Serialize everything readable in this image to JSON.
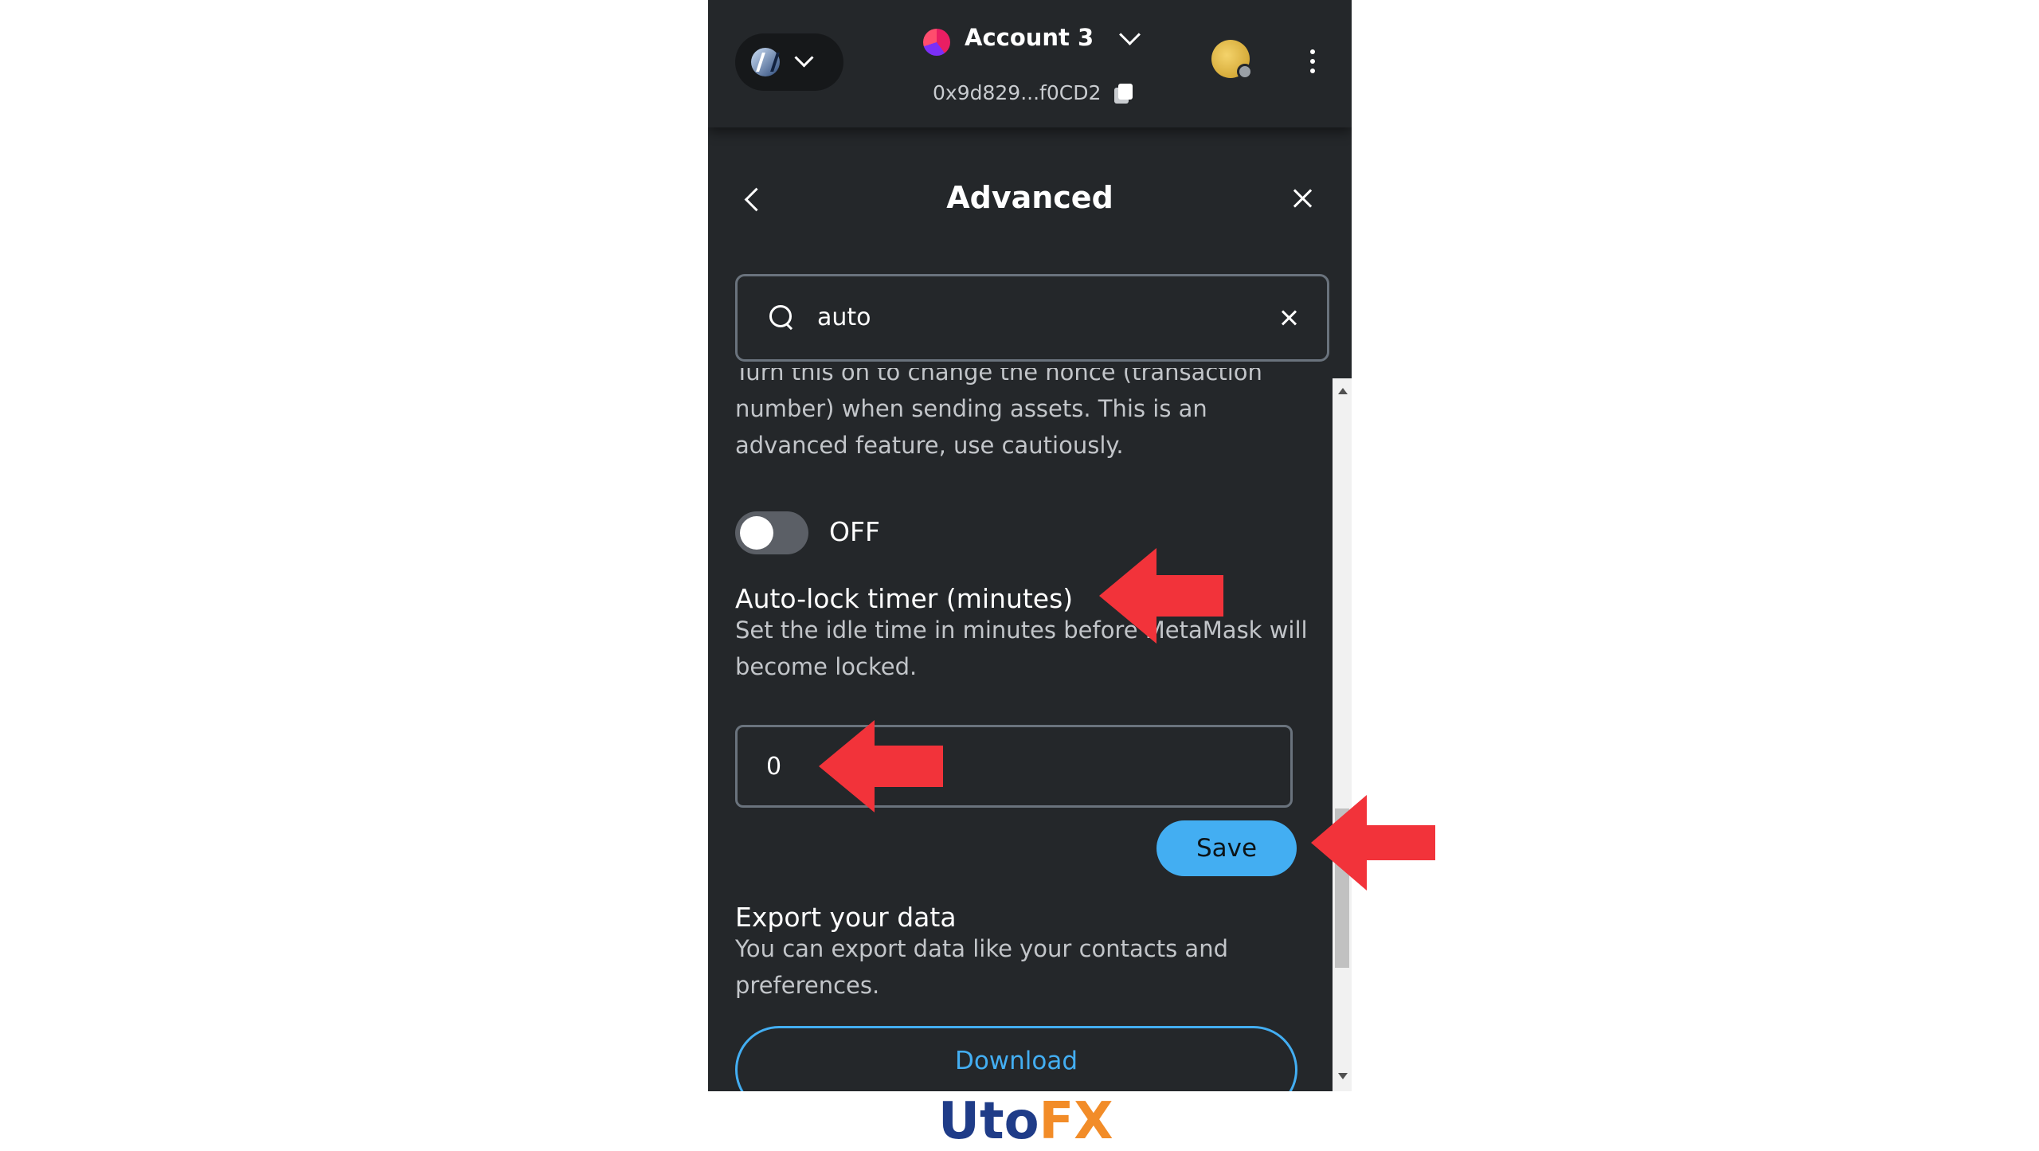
{
  "header": {
    "account_name": "Account 3",
    "address": "0x9d829...f0CD2"
  },
  "page": {
    "title": "Advanced"
  },
  "search": {
    "value": "auto"
  },
  "settings": {
    "nonce_desc": "Turn this on to change the nonce (transaction number) when sending assets. This is an advanced feature, use cautiously.",
    "toggle_label": "OFF",
    "autolock_title": "Auto-lock timer (minutes)",
    "autolock_desc": "Set the idle time in minutes before MetaMask will become locked.",
    "autolock_value": "0",
    "save_label": "Save",
    "export_title": "Export your data",
    "export_desc": "You can export data like your contacts and preferences.",
    "download_label": "Download"
  },
  "logo": {
    "text_main": "Uto",
    "text_accent": "FX"
  },
  "colors": {
    "background": "#24272a",
    "accent": "#43aef2",
    "arrow": "#f2333a"
  }
}
